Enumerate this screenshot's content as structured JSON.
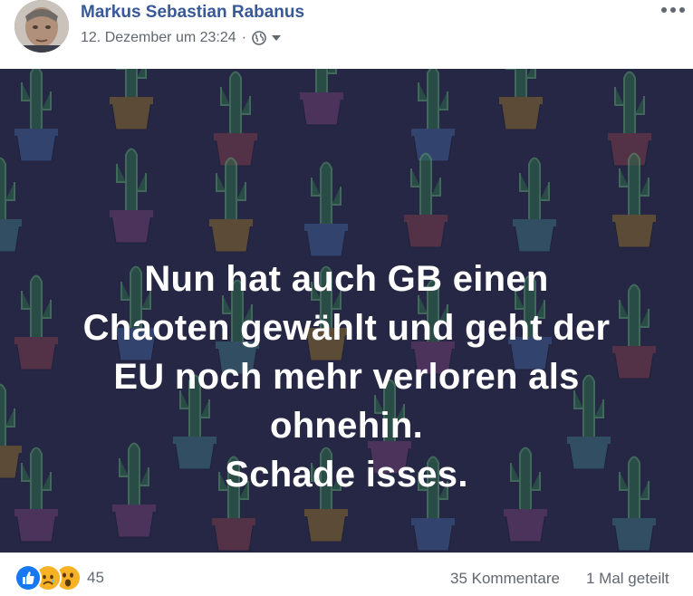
{
  "post": {
    "author": "Markus Sebastian Rabanus",
    "timestamp": "12. Dezember um 23:24",
    "separator": "·",
    "audience_icon": "globe-icon",
    "audience_dropdown_icon": "caret-down-icon",
    "more_options_icon": "more-horizontal-icon",
    "image_text_lines": [
      "Nun hat auch GB einen",
      "Chaoten gewählt und geht der",
      "EU noch mehr verloren als",
      "ohnehin.",
      "Schade isses."
    ],
    "image_background": "#252745",
    "pattern": "cactus-pots"
  },
  "engagement": {
    "reaction_icons": [
      "like-icon",
      "sad-icon",
      "wow-icon"
    ],
    "reaction_count": "45",
    "comments": "35 Kommentare",
    "shares": "1 Mal geteilt"
  },
  "colors": {
    "author_link": "#385898",
    "meta_text": "#616770",
    "like_blue": "#1877f2",
    "emoji_yellow": "#f7b125"
  }
}
